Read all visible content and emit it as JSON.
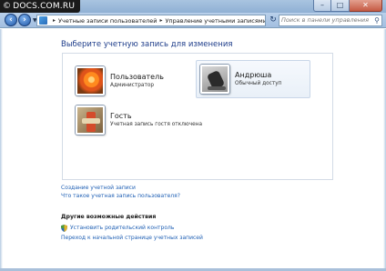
{
  "watermark": {
    "text": "DOCS.COM.RU"
  },
  "window_controls": {
    "minimize": "–",
    "maximize": "□",
    "close": "✕"
  },
  "navigation": {
    "back_icon": "back-arrow-icon",
    "forward_icon": "forward-arrow-icon"
  },
  "address": {
    "breadcrumbs": [
      "Учетные записи пользователей",
      "Управление учетными записями"
    ]
  },
  "search": {
    "placeholder": "Поиск в панели управления"
  },
  "main": {
    "title": "Выберите учетную запись для изменения",
    "accounts": [
      {
        "name": "Пользователь",
        "role": "Администратор",
        "avatar": "flower-avatar"
      },
      {
        "name": "Андрюша",
        "role": "Обычный доступ",
        "avatar": "skate-avatar"
      },
      {
        "name": "Гость",
        "role": "Учетная запись гостя отключена",
        "avatar": "guest-avatar"
      }
    ],
    "links": [
      "Создание учетной записи",
      "Что такое учетная запись пользователя?"
    ],
    "other_actions_title": "Другие возможные действия",
    "other_actions": [
      "Установить родительский контроль",
      "Переход к начальной странице учетных записей"
    ]
  },
  "colors": {
    "title_blue": "#1e3d8a",
    "link_blue": "#1e5fb4"
  }
}
